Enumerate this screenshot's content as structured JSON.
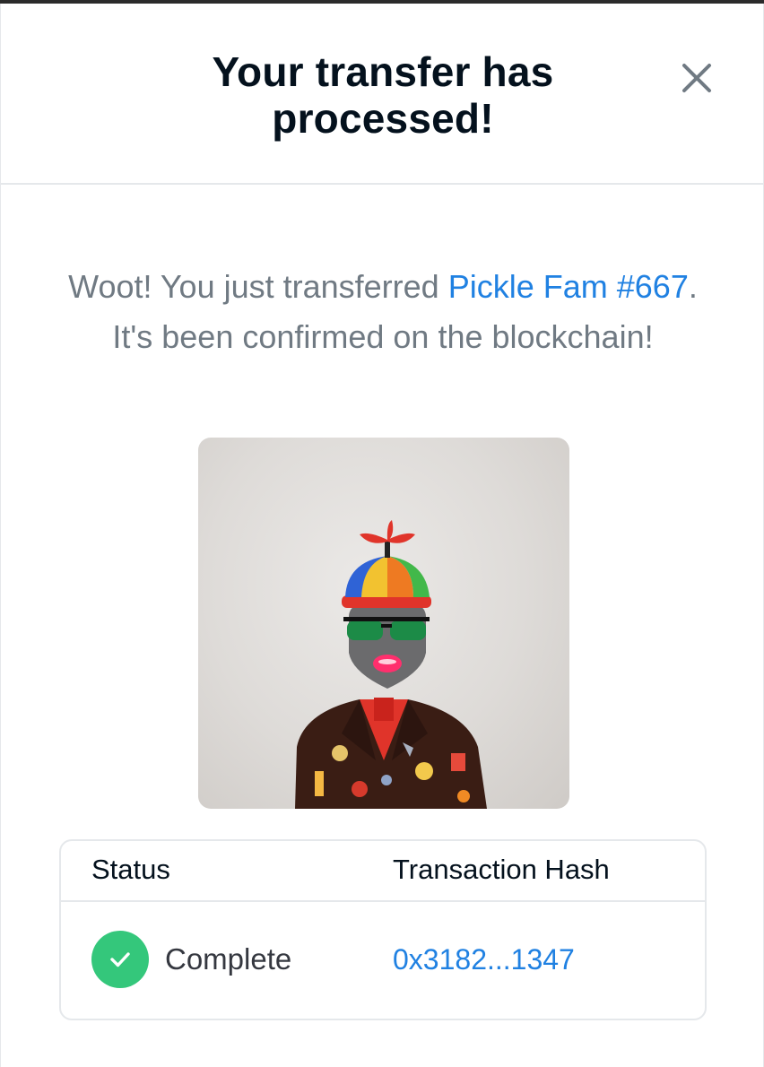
{
  "modal": {
    "title": "Your transfer has processed!",
    "close_icon": "close-icon"
  },
  "message": {
    "prefix": "Woot! You just transferred ",
    "item_name": "Pickle Fam #667",
    "suffix": ". It's been confirmed on the blockchain!"
  },
  "nft": {
    "image_icon": "nft-character-artwork"
  },
  "table": {
    "headers": [
      "Status",
      "Transaction Hash"
    ],
    "row": {
      "status": "Complete",
      "status_icon": "check-icon",
      "hash": "0x3182...1347"
    }
  },
  "colors": {
    "link": "#2081e2",
    "success": "#34c77b",
    "title": "#04111d",
    "muted": "#707a83",
    "border": "#e5e8eb"
  }
}
